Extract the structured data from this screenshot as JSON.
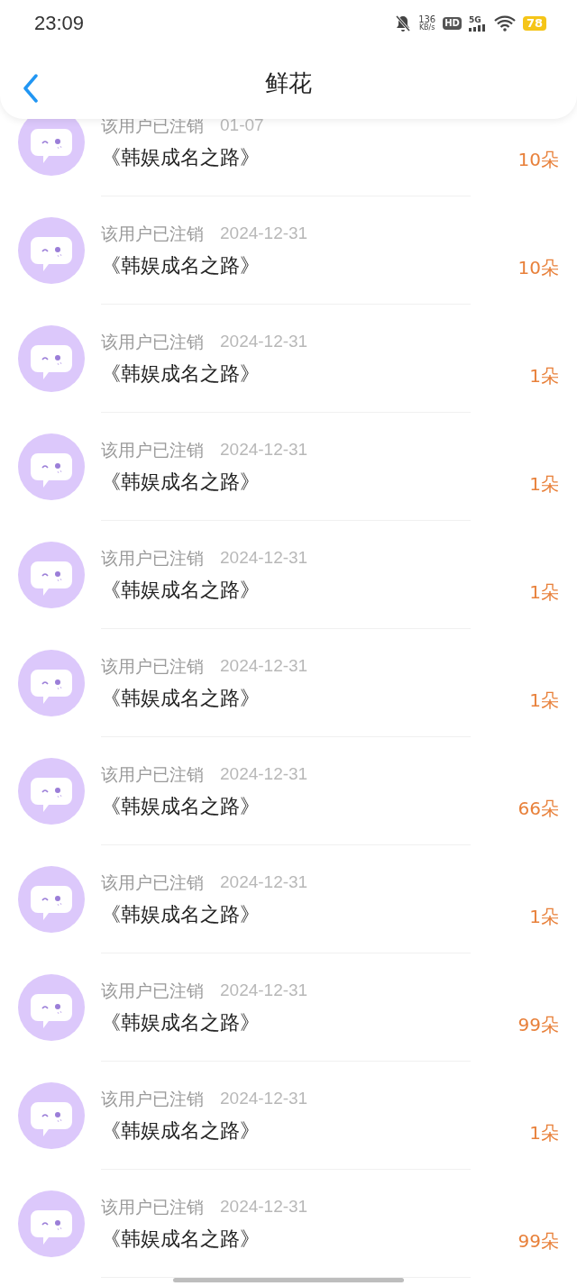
{
  "status_bar": {
    "time": "23:09",
    "speed": "136",
    "speed_unit": "KB/s",
    "hd": "HD",
    "network": "5G",
    "battery": "78"
  },
  "header": {
    "title": "鲜花"
  },
  "items": [
    {
      "user": "该用户已注销",
      "date": "01-07",
      "book": "《韩娱成名之路》",
      "amount": "10朵"
    },
    {
      "user": "该用户已注销",
      "date": "2024-12-31",
      "book": "《韩娱成名之路》",
      "amount": "10朵"
    },
    {
      "user": "该用户已注销",
      "date": "2024-12-31",
      "book": "《韩娱成名之路》",
      "amount": "1朵"
    },
    {
      "user": "该用户已注销",
      "date": "2024-12-31",
      "book": "《韩娱成名之路》",
      "amount": "1朵"
    },
    {
      "user": "该用户已注销",
      "date": "2024-12-31",
      "book": "《韩娱成名之路》",
      "amount": "1朵"
    },
    {
      "user": "该用户已注销",
      "date": "2024-12-31",
      "book": "《韩娱成名之路》",
      "amount": "1朵"
    },
    {
      "user": "该用户已注销",
      "date": "2024-12-31",
      "book": "《韩娱成名之路》",
      "amount": "66朵"
    },
    {
      "user": "该用户已注销",
      "date": "2024-12-31",
      "book": "《韩娱成名之路》",
      "amount": "1朵"
    },
    {
      "user": "该用户已注销",
      "date": "2024-12-31",
      "book": "《韩娱成名之路》",
      "amount": "99朵"
    },
    {
      "user": "该用户已注销",
      "date": "2024-12-31",
      "book": "《韩娱成名之路》",
      "amount": "1朵"
    },
    {
      "user": "该用户已注销",
      "date": "2024-12-31",
      "book": "《韩娱成名之路》",
      "amount": "99朵"
    }
  ]
}
